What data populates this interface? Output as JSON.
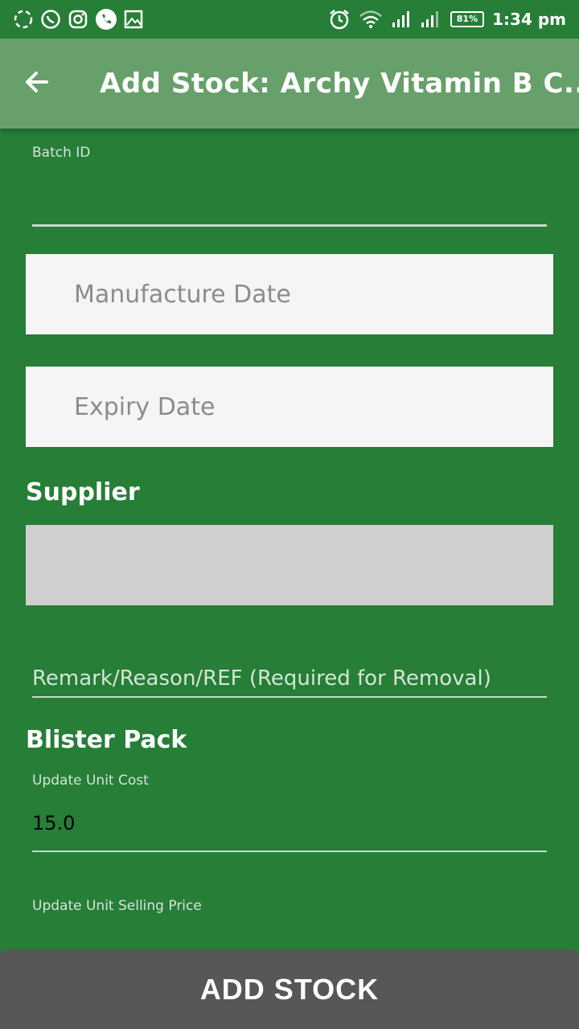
{
  "status_bar": {
    "left_icons": [
      "sync-icon",
      "whatsapp-icon",
      "instagram-icon",
      "phone-icon",
      "gallery-icon"
    ],
    "right_icons": [
      "alarm-icon",
      "wifi-icon",
      "signal-icon",
      "signal-icon"
    ],
    "battery": "81%",
    "time": "1:34 pm"
  },
  "app_bar": {
    "title": "Add Stock: Archy Vitamin B C...",
    "back_icon": "arrow-left-icon"
  },
  "form": {
    "batch_id_label": "Batch ID",
    "batch_id_value": "",
    "manufacture_date_placeholder": "Manufacture Date",
    "expiry_date_placeholder": "Expiry Date",
    "supplier_title": "Supplier",
    "remark_placeholder": "Remark/Reason/REF (Required for Removal)",
    "blister_pack_title": "Blister Pack",
    "unit_cost_label": "Update Unit Cost",
    "unit_cost_value": "15.0",
    "unit_selling_price_label": "Update Unit Selling Price"
  },
  "actions": {
    "add_stock_label": "ADD STOCK"
  },
  "colors": {
    "background": "#267e37",
    "app_bar": "#67a06a",
    "button": "#575757",
    "date_box": "#f5f5f5",
    "supplier_box": "#cfcfcf"
  }
}
